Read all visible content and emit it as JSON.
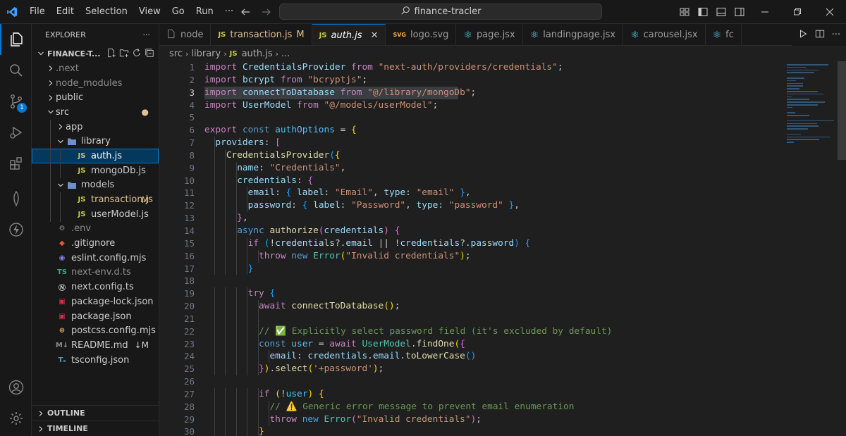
{
  "titlebar": {
    "menu": [
      "File",
      "Edit",
      "Selection",
      "View",
      "Go",
      "Run",
      "···"
    ],
    "search": "finance-tracler"
  },
  "activity": {
    "source_control_badge": "1"
  },
  "explorer": {
    "title": "EXPLORER",
    "more": "···",
    "root": "FINANCE-T...",
    "tree": [
      {
        "label": ".next",
        "depth": 1,
        "chev": "›",
        "icon": "›",
        "iconColor": "#8c8c8c",
        "kind": "folder",
        "dim": true
      },
      {
        "label": "node_modules",
        "depth": 1,
        "chev": "›",
        "icon": "",
        "kind": "folder",
        "dim": true
      },
      {
        "label": "public",
        "depth": 1,
        "chev": "›",
        "icon": "",
        "kind": "folder"
      },
      {
        "label": "src",
        "depth": 1,
        "chev": "⌄",
        "icon": "",
        "kind": "folder",
        "dot": true
      },
      {
        "label": "app",
        "depth": 2,
        "chev": "›",
        "icon": "",
        "kind": "folder"
      },
      {
        "label": "library",
        "depth": 2,
        "chev": "⌄",
        "icon": "📁",
        "kind": "folder"
      },
      {
        "label": "auth.js",
        "depth": 3,
        "chev": "",
        "icon": "JS",
        "iconColor": "#cbcb41",
        "kind": "file",
        "selected": true
      },
      {
        "label": "mongoDb.js",
        "depth": 3,
        "chev": "",
        "icon": "JS",
        "iconColor": "#cbcb41",
        "kind": "file"
      },
      {
        "label": "models",
        "depth": 2,
        "chev": "⌄",
        "icon": "📁",
        "kind": "folder"
      },
      {
        "label": "transaction.js",
        "depth": 3,
        "chev": "",
        "icon": "JS",
        "iconColor": "#cbcb41",
        "kind": "file",
        "modified": "M",
        "labelColor": "#e2c08d"
      },
      {
        "label": "userModel.js",
        "depth": 3,
        "chev": "",
        "icon": "JS",
        "iconColor": "#cbcb41",
        "kind": "file"
      },
      {
        "label": ".env",
        "depth": 1,
        "chev": "",
        "icon": "⚙",
        "iconColor": "#8c8c8c",
        "kind": "file",
        "dim": true
      },
      {
        "label": ".gitignore",
        "depth": 1,
        "chev": "",
        "icon": "◆",
        "iconColor": "#f05133",
        "kind": "file"
      },
      {
        "label": "eslint.config.mjs",
        "depth": 1,
        "chev": "",
        "icon": "◉",
        "iconColor": "#8080f2",
        "kind": "file"
      },
      {
        "label": "next-env.d.ts",
        "depth": 1,
        "chev": "",
        "icon": "TS",
        "iconColor": "#3fa37a",
        "kind": "file",
        "dim": true
      },
      {
        "label": "next.config.ts",
        "depth": 1,
        "chev": "",
        "icon": "Ⓝ",
        "iconColor": "#cccccc",
        "kind": "file"
      },
      {
        "label": "package-lock.json",
        "depth": 1,
        "chev": "",
        "icon": "▣",
        "iconColor": "#e8274b",
        "kind": "file"
      },
      {
        "label": "package.json",
        "depth": 1,
        "chev": "",
        "icon": "▣",
        "iconColor": "#e8274b",
        "kind": "file"
      },
      {
        "label": "postcss.config.mjs",
        "depth": 1,
        "chev": "",
        "icon": "⊛",
        "iconColor": "#e0a060",
        "kind": "file"
      },
      {
        "label": "README.md",
        "depth": 1,
        "chev": "",
        "icon": "M↓",
        "iconColor": "#8c8c8c",
        "kind": "file",
        "modified": "↓M",
        "labelColor": "#cccccc"
      },
      {
        "label": "tsconfig.json",
        "depth": 1,
        "chev": "",
        "icon": "Tₛ",
        "iconColor": "#519aba",
        "kind": "file"
      }
    ],
    "outline": "OUTLINE",
    "timeline": "TIMELINE"
  },
  "tabs": [
    {
      "label": "node",
      "icon": "",
      "iconColor": "#8c8c8c"
    },
    {
      "label": "transaction.js",
      "icon": "JS",
      "iconColor": "#cbcb41",
      "mod": "M",
      "labelColor": "#e2c08d"
    },
    {
      "label": "auth.js",
      "icon": "JS",
      "iconColor": "#cbcb41",
      "active": true,
      "close": "✕"
    },
    {
      "label": "logo.svg",
      "icon": "SVG",
      "iconColor": "#ffb13b"
    },
    {
      "label": "page.jsx",
      "icon": "⚛",
      "iconColor": "#61dafb"
    },
    {
      "label": "landingpage.jsx",
      "icon": "⚛",
      "iconColor": "#61dafb"
    },
    {
      "label": "carousel.jsx",
      "icon": "⚛",
      "iconColor": "#61dafb"
    },
    {
      "label": "fc",
      "icon": "⚛",
      "iconColor": "#61dafb"
    }
  ],
  "breadcrumb": [
    "src",
    "library",
    "auth.js",
    "..."
  ],
  "breadcrumb_icon": "JS",
  "line_numbers": [
    "1",
    "2",
    "3",
    "4",
    "5",
    "6",
    "7",
    "8",
    "9",
    "10",
    "11",
    "12",
    "13",
    "14",
    "15",
    "16",
    "17",
    "18",
    "19",
    "20",
    "21",
    "22",
    "23",
    "24",
    "25",
    "26",
    "27",
    "28",
    "29",
    "30"
  ],
  "current_line": 3,
  "code": [
    [
      [
        "import ",
        "k1"
      ],
      [
        "CredentialsProvider ",
        "vr"
      ],
      [
        "from ",
        "k1"
      ],
      [
        "\"next-auth/providers/credentials\"",
        "st"
      ],
      [
        ";",
        "pn"
      ]
    ],
    [
      [
        "import ",
        "k1"
      ],
      [
        "bcrypt ",
        "vr"
      ],
      [
        "from ",
        "k1"
      ],
      [
        "\"bcryptjs\"",
        "st"
      ],
      [
        ";",
        "pn"
      ]
    ],
    [
      [
        "import ",
        "k1"
      ],
      [
        "connectToDatabase ",
        "vr"
      ],
      [
        "from ",
        "k1"
      ],
      [
        "\"@/library/mongoDb\"",
        "st"
      ],
      [
        ";",
        "pn"
      ]
    ],
    [
      [
        "import ",
        "k1"
      ],
      [
        "UserModel ",
        "vr"
      ],
      [
        "from ",
        "k1"
      ],
      [
        "\"@/models/userModel\"",
        "st"
      ],
      [
        ";",
        "pn"
      ]
    ],
    [],
    [
      [
        "export ",
        "k1"
      ],
      [
        "const ",
        "k2"
      ],
      [
        "authOptions ",
        "cn"
      ],
      [
        "= ",
        "pn"
      ],
      [
        "{",
        "b1"
      ]
    ],
    [
      [
        "  providers",
        "vr"
      ],
      [
        ": ",
        "pn"
      ],
      [
        "[",
        "b2"
      ]
    ],
    [
      [
        "    CredentialsProvider",
        "fn"
      ],
      [
        "(",
        "b3"
      ],
      [
        "{",
        "b1"
      ]
    ],
    [
      [
        "      name",
        "vr"
      ],
      [
        ": ",
        "pn"
      ],
      [
        "\"Credentials\"",
        "st"
      ],
      [
        ",",
        "pn"
      ]
    ],
    [
      [
        "      credentials",
        "vr"
      ],
      [
        ": ",
        "pn"
      ],
      [
        "{",
        "b2"
      ]
    ],
    [
      [
        "        email",
        "vr"
      ],
      [
        ": ",
        "pn"
      ],
      [
        "{ ",
        "b3"
      ],
      [
        "label",
        "vr"
      ],
      [
        ": ",
        "pn"
      ],
      [
        "\"Email\"",
        "st"
      ],
      [
        ", ",
        "pn"
      ],
      [
        "type",
        "vr"
      ],
      [
        ": ",
        "pn"
      ],
      [
        "\"email\" ",
        "st"
      ],
      [
        "}",
        "b3"
      ],
      [
        ",",
        "pn"
      ]
    ],
    [
      [
        "        password",
        "vr"
      ],
      [
        ": ",
        "pn"
      ],
      [
        "{ ",
        "b3"
      ],
      [
        "label",
        "vr"
      ],
      [
        ": ",
        "pn"
      ],
      [
        "\"Password\"",
        "st"
      ],
      [
        ", ",
        "pn"
      ],
      [
        "type",
        "vr"
      ],
      [
        ": ",
        "pn"
      ],
      [
        "\"password\" ",
        "st"
      ],
      [
        "}",
        "b3"
      ],
      [
        ",",
        "pn"
      ]
    ],
    [
      [
        "      ",
        "pn"
      ],
      [
        "}",
        "b2"
      ],
      [
        ",",
        "pn"
      ]
    ],
    [
      [
        "      async ",
        "k2"
      ],
      [
        "authorize",
        "fn"
      ],
      [
        "(",
        "b2"
      ],
      [
        "credentials",
        "vr"
      ],
      [
        ") ",
        "b2"
      ],
      [
        "{",
        "b2"
      ]
    ],
    [
      [
        "        if ",
        "k1"
      ],
      [
        "(",
        "b3"
      ],
      [
        "!",
        "pn"
      ],
      [
        "credentials",
        "vr"
      ],
      [
        "?.",
        "pn"
      ],
      [
        "email ",
        "vr"
      ],
      [
        "|| ",
        "pn"
      ],
      [
        "!",
        "pn"
      ],
      [
        "credentials",
        "vr"
      ],
      [
        "?.",
        "pn"
      ],
      [
        "password",
        "vr"
      ],
      [
        ") ",
        "b3"
      ],
      [
        "{",
        "b3"
      ]
    ],
    [
      [
        "          throw ",
        "k1"
      ],
      [
        "new ",
        "k2"
      ],
      [
        "Error",
        "cls"
      ],
      [
        "(",
        "b1"
      ],
      [
        "\"Invalid credentials\"",
        "st"
      ],
      [
        ")",
        "b1"
      ],
      [
        ";",
        "pn"
      ]
    ],
    [
      [
        "        ",
        "pn"
      ],
      [
        "}",
        "b3"
      ]
    ],
    [],
    [
      [
        "        try ",
        "k1"
      ],
      [
        "{",
        "b3"
      ]
    ],
    [
      [
        "          await ",
        "k1"
      ],
      [
        "connectToDatabase",
        "fn"
      ],
      [
        "()",
        "b1"
      ],
      [
        ";",
        "pn"
      ]
    ],
    [],
    [
      [
        "          // ✅ Explicitly select password field (it's excluded by default)",
        "cm"
      ]
    ],
    [
      [
        "          const ",
        "k2"
      ],
      [
        "user ",
        "cn"
      ],
      [
        "= ",
        "pn"
      ],
      [
        "await ",
        "k1"
      ],
      [
        "UserModel",
        "cls"
      ],
      [
        ".",
        "pn"
      ],
      [
        "findOne",
        "fn"
      ],
      [
        "(",
        "b1"
      ],
      [
        "{",
        "b2"
      ]
    ],
    [
      [
        "            email",
        "vr"
      ],
      [
        ": ",
        "pn"
      ],
      [
        "credentials",
        "vr"
      ],
      [
        ".",
        "pn"
      ],
      [
        "email",
        "vr"
      ],
      [
        ".",
        "pn"
      ],
      [
        "toLowerCase",
        "fn"
      ],
      [
        "()",
        "b3"
      ]
    ],
    [
      [
        "          ",
        "pn"
      ],
      [
        "}",
        "b2"
      ],
      [
        ")",
        "b1"
      ],
      [
        ".",
        "pn"
      ],
      [
        "select",
        "fn"
      ],
      [
        "(",
        "b1"
      ],
      [
        "'+password'",
        "st"
      ],
      [
        ")",
        "b1"
      ],
      [
        ";",
        "pn"
      ]
    ],
    [],
    [
      [
        "          if ",
        "k1"
      ],
      [
        "(",
        "b1"
      ],
      [
        "!",
        "pn"
      ],
      [
        "user",
        "cn"
      ],
      [
        ") ",
        "b1"
      ],
      [
        "{",
        "b1"
      ]
    ],
    [
      [
        "            // ⚠️ Generic error message to prevent email enumeration",
        "cm"
      ]
    ],
    [
      [
        "            throw ",
        "k1"
      ],
      [
        "new ",
        "k2"
      ],
      [
        "Error",
        "cls"
      ],
      [
        "(",
        "b2"
      ],
      [
        "\"Invalid credentials\"",
        "st"
      ],
      [
        ")",
        "b2"
      ],
      [
        ";",
        "pn"
      ]
    ],
    [
      [
        "          ",
        "pn"
      ],
      [
        "}",
        "b1"
      ]
    ]
  ],
  "colors": {
    "accent": "#0078d4",
    "modified": "#e2c08d",
    "badge": "#0078d4"
  }
}
